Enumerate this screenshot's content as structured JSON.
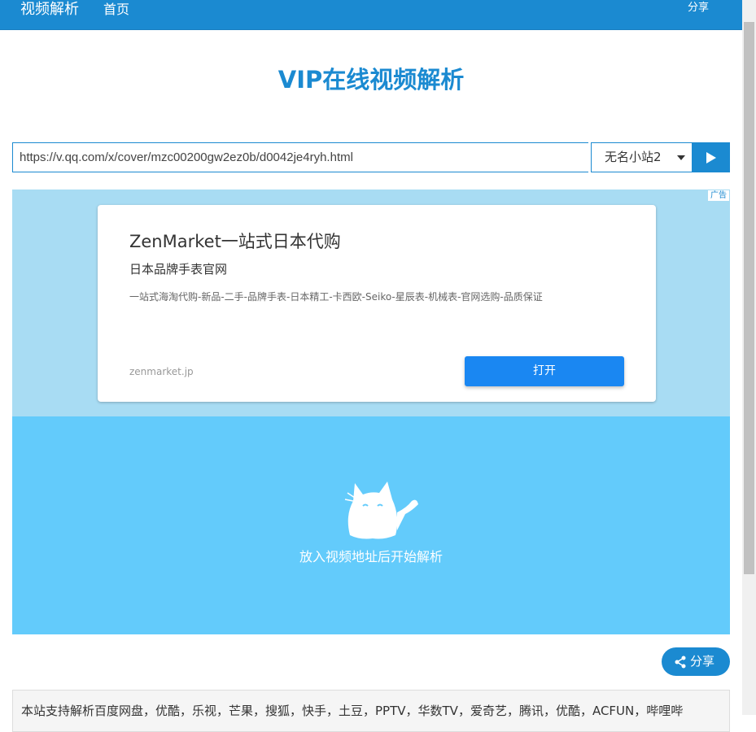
{
  "navbar": {
    "brand": "视频解析",
    "home_label": "首页",
    "share_label": "分享"
  },
  "page": {
    "title": "VIP在线视频解析"
  },
  "search": {
    "url_value": "https://v.qq.com/x/cover/mzc00200gw2ez0b/d0042je4ryh.html",
    "source_selected": "无名小站2",
    "play_icon": "play-icon"
  },
  "ad": {
    "badge": "广告",
    "title": "ZenMarket一站式日本代购",
    "subtitle": "日本品牌手表官网",
    "description": "一站式海淘代购-新品-二手-品牌手表-日本精工-卡西欧-Seiko-星辰表-机械表-官网选购-品质保证",
    "domain": "zenmarket.jp",
    "open_label": "打开"
  },
  "player": {
    "message": "放入视频地址后开始解析",
    "icon": "cat-icon"
  },
  "share_button": {
    "label": "分享",
    "icon": "share-icon"
  },
  "info": {
    "text": "本站支持解析百度网盘，优酷，乐视，芒果，搜狐，快手，土豆，PPTV，华数TV，爱奇艺，腾讯，优酷，ACFUN，哔哩哔"
  },
  "colors": {
    "primary": "#1b8ad1",
    "ad_background": "#a8dcf3",
    "player_background": "#63cbfb",
    "ad_button": "#1a87f2"
  }
}
